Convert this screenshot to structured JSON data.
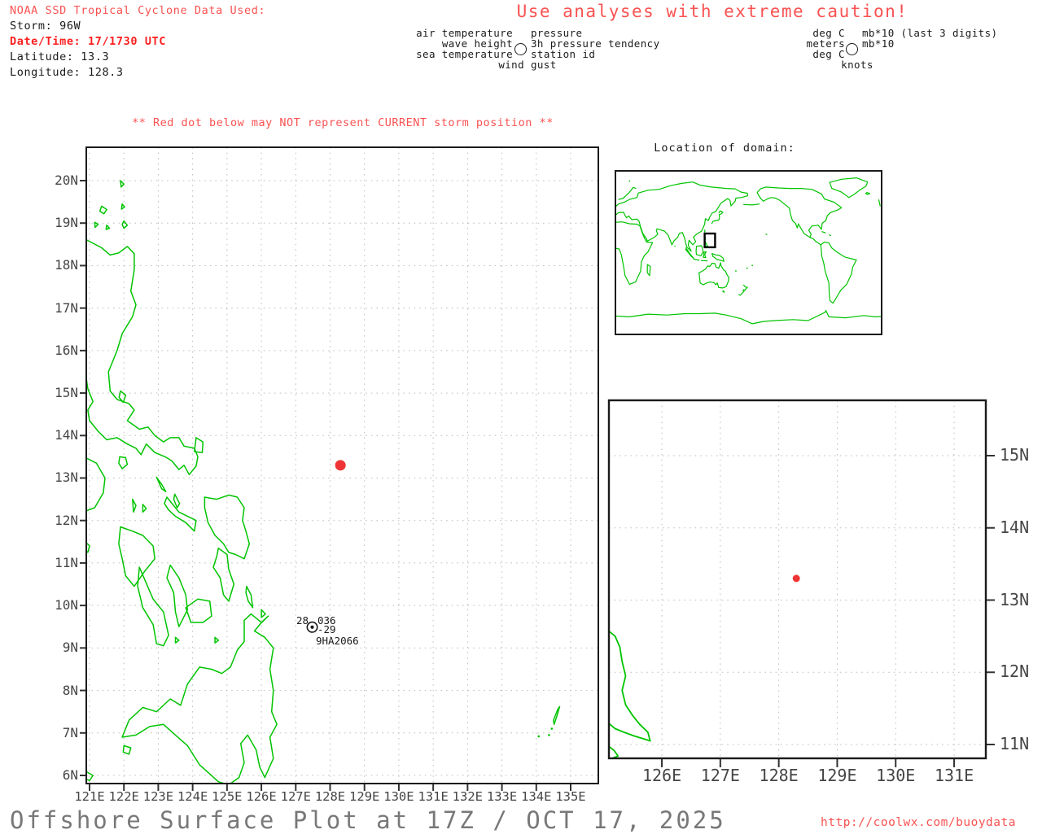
{
  "header": {
    "noaa_title": "NOAA SSD Tropical Cyclone Data Used:",
    "storm_line": "Storm: 96W",
    "datetime_line": "Date/Time: 17/1730 UTC",
    "latitude_line": "Latitude: 13.3",
    "longitude_line": "Longitude: 128.3",
    "caution": "Use analyses with extreme caution!"
  },
  "station_model_legend": {
    "air_temperature": "air temperature",
    "wave_height": "wave height",
    "sea_temperature": "sea temperature",
    "wind_gust": "wind gust",
    "pressure": "pressure",
    "pressure_tendency": "3h pressure tendency",
    "station_id": "station id",
    "unit_air": "deg C",
    "unit_wave": "meters",
    "unit_sea": "deg C",
    "unit_wind": "knots",
    "unit_pressure": "mb*10 (last 3 digits)",
    "unit_tendency": "mb*10"
  },
  "warning": "** Red dot below may NOT represent CURRENT storm position **",
  "main_map": {
    "lat_labels": [
      "20N",
      "19N",
      "18N",
      "17N",
      "16N",
      "15N",
      "14N",
      "13N",
      "12N",
      "11N",
      "10N",
      "9N",
      "8N",
      "7N",
      "6N"
    ],
    "lon_labels": [
      "121E",
      "122E",
      "123E",
      "124E",
      "125E",
      "126E",
      "127E",
      "128E",
      "129E",
      "130E",
      "131E",
      "132E",
      "133E",
      "134E",
      "135E"
    ],
    "storm_dot": {
      "lon": 128.3,
      "lat": 13.3
    },
    "station": {
      "air_temp": "28",
      "pressure": "036",
      "tendency": "-29",
      "id": "9HA2066",
      "lon": 127.48,
      "lat": 9.49
    }
  },
  "domain_map": {
    "title": "Location of domain:"
  },
  "inset_map": {
    "lat_labels": [
      "15N",
      "14N",
      "13N",
      "12N",
      "11N"
    ],
    "lon_labels": [
      "126E",
      "127E",
      "128E",
      "129E",
      "130E",
      "131E"
    ],
    "storm_dot": {
      "lon": 128.3,
      "lat": 13.3
    }
  },
  "footer": {
    "title": "Offshore Surface Plot at 17Z / OCT 17, 2025",
    "url": "http://coolwx.com/buoydata"
  },
  "colors": {
    "salmon": "#fa5252",
    "boldred": "#fb1f1f",
    "dotred": "#ee3434",
    "green": "#00c400",
    "grid": "#bdbdbd",
    "frame": "#1a1a1a"
  }
}
